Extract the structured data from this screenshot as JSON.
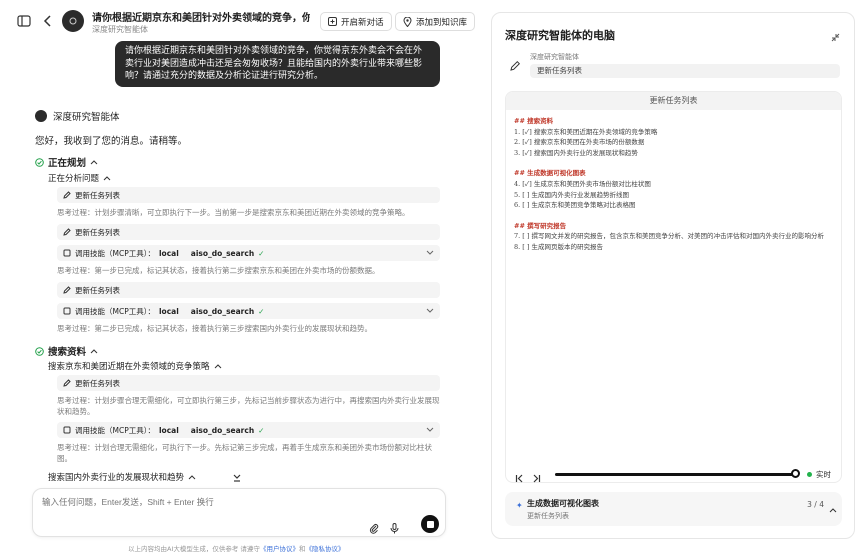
{
  "header": {
    "title": "请你根据近期京东和美团针对外卖领域的竞争，你觉得...",
    "subtitle": "深度研究智能体",
    "new_chat": "开启新对话",
    "add_kb": "添加到知识库"
  },
  "user_message": "请你根据近期京东和美团针对外卖领域的竞争，你觉得京东外卖会不会在外卖行业对美团造成冲击还是会匆匆收场？且能给国内的外卖行业带来哪些影响？请通过充分的数据及分析论证进行研究分析。",
  "agent": {
    "name": "深度研究智能体",
    "greeting": "您好，我收到了您的消息。请稍等。"
  },
  "planning": {
    "title": "正在规划",
    "sub": "正在分析问题",
    "update_label": "更新任务列表",
    "think1": "思考过程：计划步骤清晰，可立即执行下一步。当前第一步是搜索京东和美团近期在外卖领域的竞争策略。",
    "think2": "思考过程：第一步已完成，标记其状态，接着执行第二步搜索京东和美团在外卖市场的份额数据。",
    "think3": "思考过程：第二步已完成，标记其状态，接着执行第三步搜索国内外卖行业的发展现状和趋势。"
  },
  "mcp": {
    "prefix": "调用技能（MCP工具）：",
    "scope": "local",
    "tool": "aiso_do_search"
  },
  "search": {
    "title": "搜索资料",
    "sub1": "搜索京东和美团近期在外卖领域的竞争策略",
    "think4": "思考过程：计划步骤合理无需细化，可立即执行第三步，先标记当前步骤状态为进行中，再搜索国内外卖行业发展现状和趋势。",
    "think5": "思考过程：计划合理无需细化，可执行下一步。先标记第三步完成，再着手生成京东和美团外卖市场份额对比柱状图。",
    "sub2": "搜索国内外卖行业的发展现状和趋势"
  },
  "input": {
    "placeholder": "输入任何问题，Enter发送，Shift + Enter 换行"
  },
  "footer": {
    "text": "以上内容均由AI大模型生成，仅供参考    请遵守",
    "link1": "《用户协议》",
    "and": "和",
    "link2": "《隐私协议》"
  },
  "panel": {
    "title": "深度研究智能体的电脑",
    "task_label": "深度研究智能体",
    "task_chip": "更新任务列表",
    "doc_title": "更新任务列表",
    "doc": {
      "h1": "## 搜索资料",
      "l1": "1. [✓] 搜索京东和美团近期在外卖领域的竞争策略",
      "l2": "2. [✓] 搜索京东和美团在外卖市场的份额数据",
      "l3": "3. [✓] 搜索国内外卖行业的发展现状和趋势",
      "h2": "## 生成数据可视化图表",
      "l4": "4. [✓] 生成京东和美团外卖市场份额对比柱状图",
      "l5": "5. [ ] 生成国内外卖行业发展趋势折线图",
      "l6": "6. [ ] 生成京东和美团竞争策略对比表格图",
      "h3": "## 撰写研究报告",
      "l7": "7. [ ] 撰写网文并发的研究报告，包含京东和美团竞争分析、对美团的冲击评估和对国内外卖行业的影响分析",
      "l8": "8. [ ] 生成网页版本的研究报告"
    },
    "live": "实时",
    "progress": 1.0,
    "current_title": "生成数据可视化图表",
    "current_sub": "更新任务列表",
    "current_count": "3 / 4"
  }
}
